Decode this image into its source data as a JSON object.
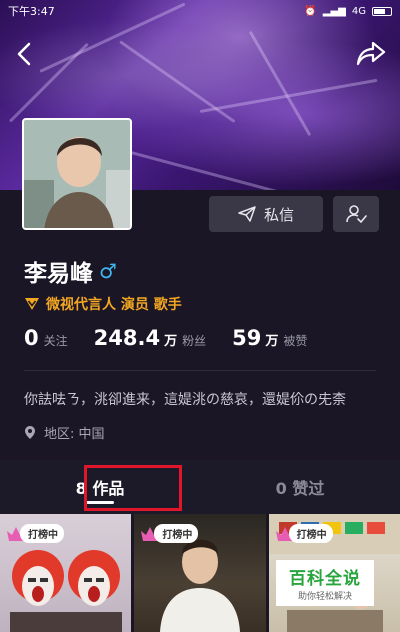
{
  "statusbar": {
    "time": "下午3:47",
    "network": "4G"
  },
  "profile": {
    "name": "李易峰",
    "gender_symbol": "♂",
    "verification": "微视代言人 演员 歌手",
    "bio": "你詓呿ㄋ，洮卻進来，這媞洮の慈哀，還媞伱の兂柰",
    "region": "地区: 中国"
  },
  "actions": {
    "message_label": "私信"
  },
  "stats": [
    {
      "num": "0",
      "unit": "",
      "label": "关注"
    },
    {
      "num": "248.4",
      "unit": "万",
      "label": "粉丝"
    },
    {
      "num": "59",
      "unit": "万",
      "label": "被赞"
    }
  ],
  "tabs": [
    {
      "label": "8 作品",
      "active": true
    },
    {
      "label": "0 赞过",
      "active": false
    }
  ],
  "badge_label": "打榜中",
  "watermark": {
    "title": "百科全说",
    "subtitle": "助你轻松解决"
  },
  "colors": {
    "accent_orange": "#f3a622",
    "gender_blue": "#3fb6f0",
    "highlight_red": "#e0162b"
  }
}
